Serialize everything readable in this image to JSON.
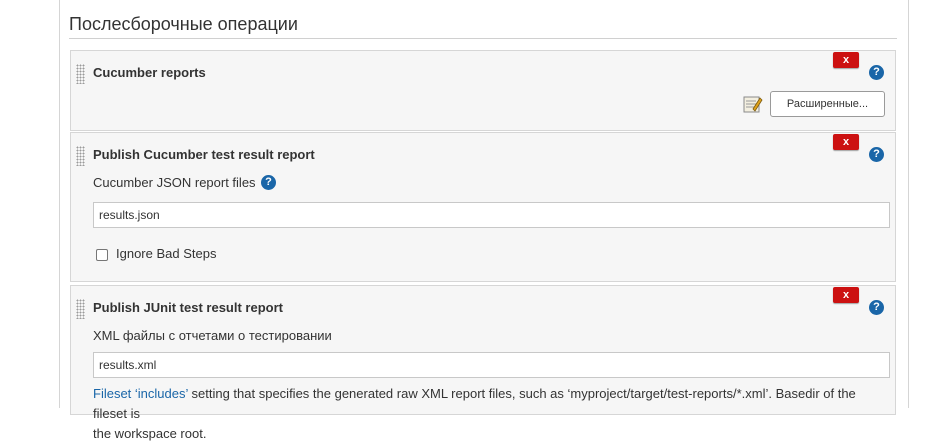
{
  "section": {
    "title": "Послесборочные операции"
  },
  "steps": [
    {
      "title": "Cucumber reports",
      "delete_label": "x",
      "help_label": "?",
      "advanced_label": "Расширенные..."
    },
    {
      "title": "Publish Cucumber test result report",
      "delete_label": "x",
      "help_label": "?",
      "field_label": "Cucumber JSON report files",
      "field_help_label": "?",
      "field_value": "results.json",
      "checkbox_label": "Ignore Bad Steps",
      "checkbox_checked": false
    },
    {
      "title": "Publish JUnit test result report",
      "delete_label": "x",
      "help_label": "?",
      "field_label": "XML файлы с отчетами о тестировании",
      "field_value": "results.xml",
      "desc_link": "Fileset ‘includes’",
      "desc_text": " setting that specifies the generated raw XML report files, such as ‘myproject/target/test-reports/*.xml’. Basedir of the fileset is",
      "desc_text_2": "the workspace root."
    }
  ],
  "colors": {
    "delete": "#cc1111",
    "help": "#1a66a8",
    "link": "#1a66a8"
  }
}
